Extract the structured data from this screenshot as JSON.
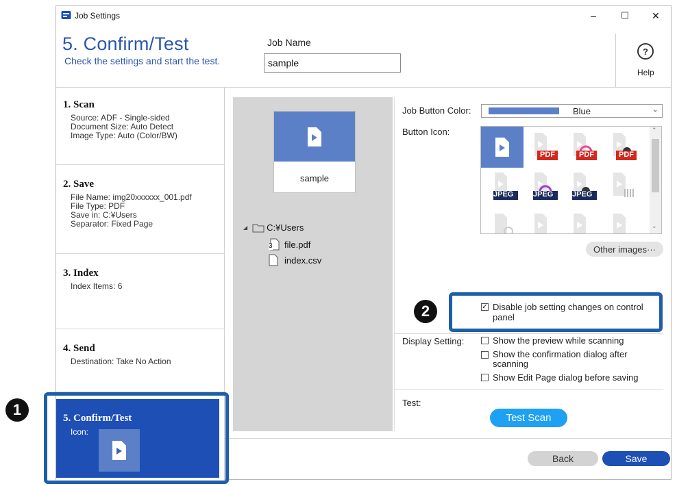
{
  "window": {
    "title": "Job Settings",
    "minimize": "–",
    "maximize": "☐",
    "close": "✕"
  },
  "header": {
    "title": "5. Confirm/Test",
    "subtitle": "Check the settings and start the test.",
    "job_name_label": "Job Name",
    "job_name_value": "sample",
    "help_glyph": "?",
    "help_label": "Help"
  },
  "steps": [
    {
      "title": "1. Scan",
      "lines": [
        "Source: ADF - Single-sided",
        "Document Size: Auto Detect",
        "Image Type: Auto (Color/BW)"
      ]
    },
    {
      "title": "2. Save",
      "lines": [
        "File Name: img20xxxxxx_001.pdf",
        "File Type: PDF",
        "Save in: C:¥Users",
        "Separator: Fixed Page"
      ]
    },
    {
      "title": "3. Index",
      "lines": [
        "Index Items: 6"
      ]
    },
    {
      "title": "4. Send",
      "lines": [
        "Destination: Take No Action"
      ]
    },
    {
      "title": "5. Confirm/Test",
      "lines": [
        "Icon:"
      ]
    }
  ],
  "preview": {
    "tile_label": "sample",
    "tree": {
      "folder": "C:¥Users",
      "page_count": "3",
      "files": [
        "file.pdf",
        "index.csv"
      ]
    }
  },
  "settings": {
    "button_color_label": "Job Button Color:",
    "button_color_value": "Blue",
    "button_color_hex": "#5b80c8",
    "button_icon_label": "Button Icon:",
    "icon_badges": [
      "PDF",
      "PDF",
      "PDF",
      "JPEG",
      "JPEG",
      "JPEG"
    ],
    "other_images_label": "Other images···",
    "disable_changes_label": "Disable job setting changes on control panel",
    "disable_changes_checked": true,
    "display_setting_label": "Display Setting:",
    "display_options": [
      {
        "label": "Show the preview while scanning",
        "checked": false
      },
      {
        "label": "Show the confirmation dialog after scanning",
        "checked": false
      },
      {
        "label": "Show Edit Page dialog before saving",
        "checked": false
      }
    ],
    "test_label": "Test:",
    "test_scan_label": "Test Scan"
  },
  "footer": {
    "back_label": "Back",
    "save_label": "Save"
  },
  "callouts": {
    "one": "1",
    "two": "2"
  },
  "colors": {
    "accent": "#1d4fb5",
    "header_text": "#2a56b0",
    "test_button": "#1ea1f2",
    "highlight": "#1d5fa8"
  }
}
